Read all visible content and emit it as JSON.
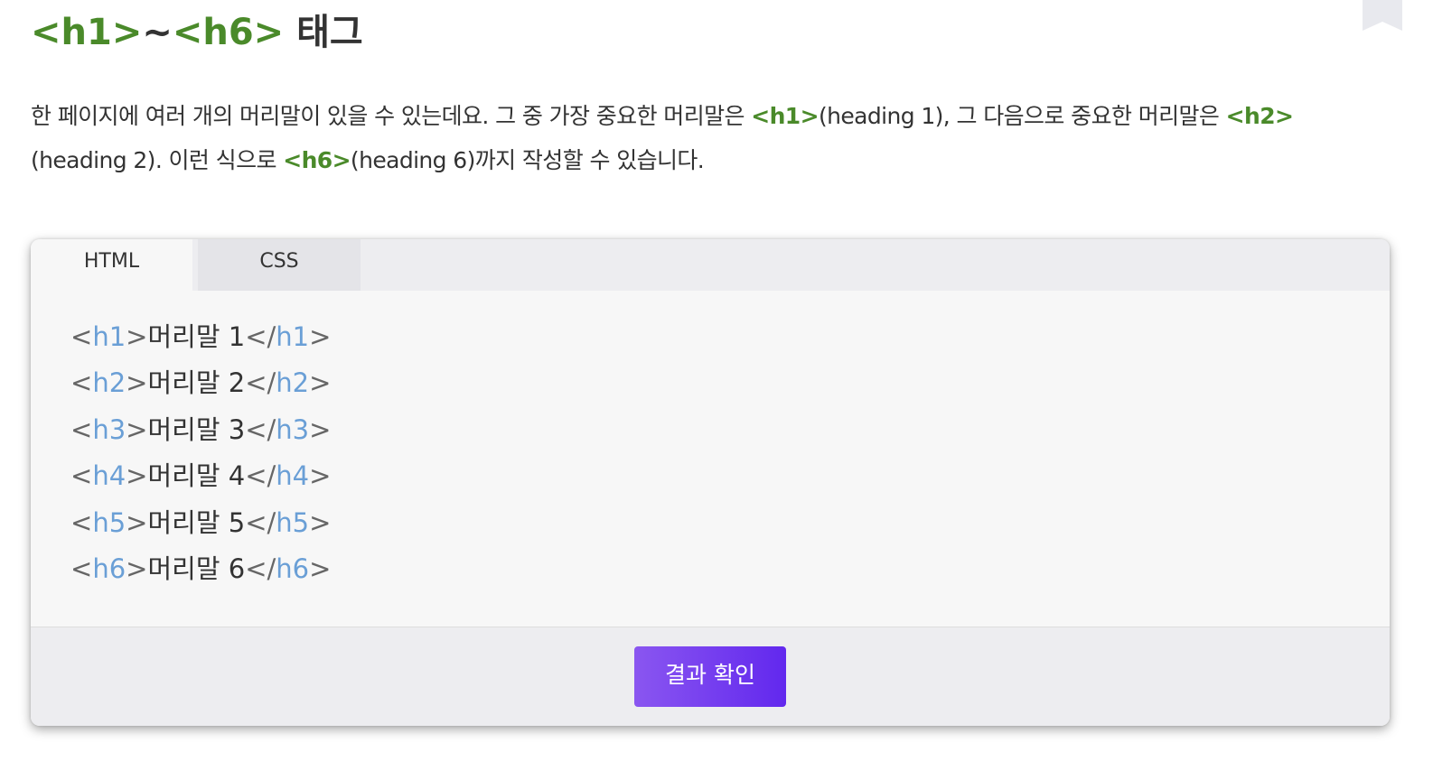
{
  "heading": {
    "tag_h1": "<h1>",
    "tilde": "~",
    "tag_h6": "<h6>",
    "suffix": " 태그"
  },
  "paragraph": {
    "part1": "한 페이지에 여러 개의 머리말이 있을 수 있는데요. 그 중 가장 중요한 머리말은 ",
    "tag1": "<h1>",
    "part2": "(heading 1), 그 다음으로 중요한 머리말은 ",
    "tag2": "<h2>",
    "part3": "(heading 2). 이런 식으로 ",
    "tag3": "<h6>",
    "part4": "(heading 6)까지 작성할 수 있습니다."
  },
  "example": {
    "tabs": [
      {
        "label": "HTML",
        "active": true
      },
      {
        "label": "CSS",
        "active": false
      }
    ],
    "code_lines": [
      {
        "tag": "h1",
        "text": "머리말 1"
      },
      {
        "tag": "h2",
        "text": "머리말 2"
      },
      {
        "tag": "h3",
        "text": "머리말 3"
      },
      {
        "tag": "h4",
        "text": "머리말 4"
      },
      {
        "tag": "h5",
        "text": "머리말 5"
      },
      {
        "tag": "h6",
        "text": "머리말 6"
      }
    ],
    "run_button_label": "결과 확인"
  },
  "icons": {
    "bookmark": "bookmark-icon"
  },
  "colors": {
    "tag_green": "#4a8a2a",
    "code_tag_blue": "#6a9fd6",
    "button_gradient_start": "#8a56f0",
    "button_gradient_end": "#6228ee"
  }
}
